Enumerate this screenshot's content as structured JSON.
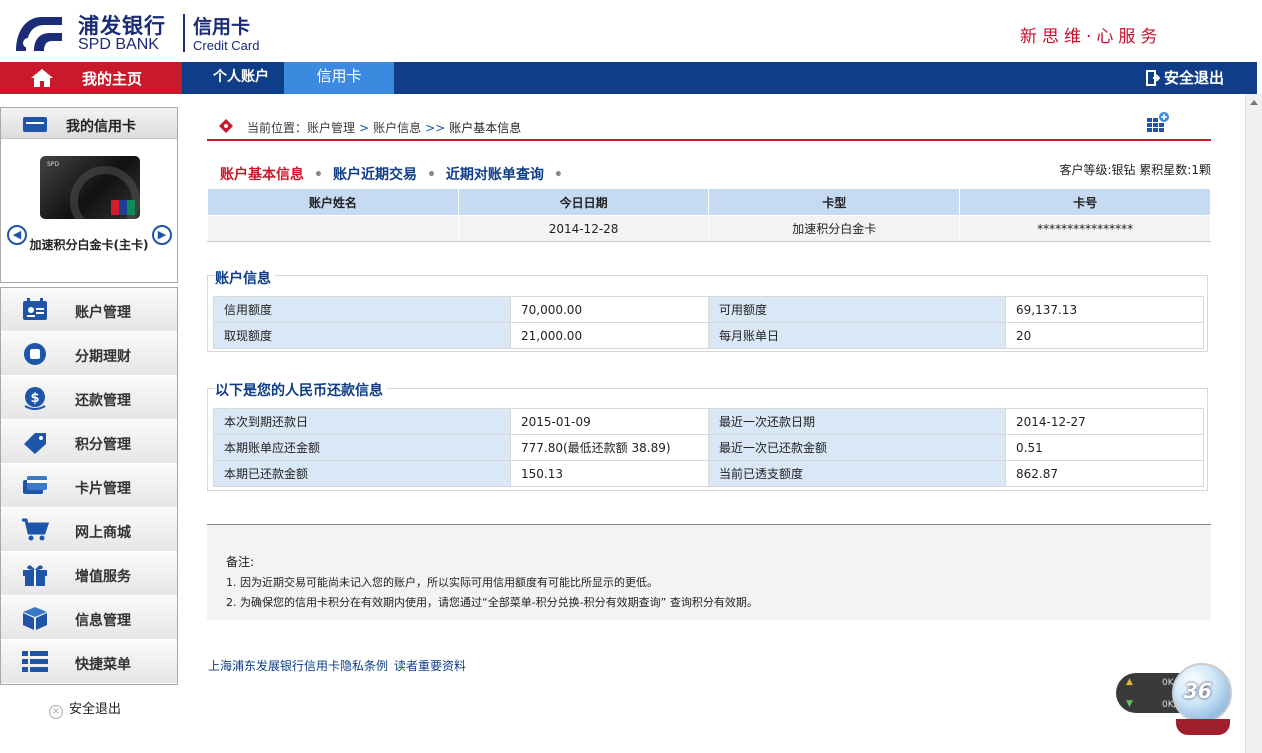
{
  "brand": {
    "name_cn": "浦发银行",
    "name_en": "SPD BANK",
    "product_cn": "信用卡",
    "product_en": "Credit Card",
    "slogan": "新思维·心服务",
    "accent_red": "#c81a2a",
    "accent_blue": "#0f3d87"
  },
  "nav": {
    "home": "我的主页",
    "personal": "个人账户",
    "credit": "信用卡",
    "logout": "安全退出"
  },
  "sidebar": {
    "card_header": "我的信用卡",
    "card_name": "加速积分白金卡(主卡)",
    "menu": [
      {
        "label": "账户管理",
        "icon": "account-icon"
      },
      {
        "label": "分期理财",
        "icon": "installment-icon"
      },
      {
        "label": "还款管理",
        "icon": "repayment-icon"
      },
      {
        "label": "积分管理",
        "icon": "points-icon"
      },
      {
        "label": "卡片管理",
        "icon": "card-manage-icon"
      },
      {
        "label": "网上商城",
        "icon": "cart-icon"
      },
      {
        "label": "增值服务",
        "icon": "gift-icon"
      },
      {
        "label": "信息管理",
        "icon": "box-icon"
      },
      {
        "label": "快捷菜单",
        "icon": "list-icon"
      }
    ],
    "logout": "安全退出"
  },
  "breadcrumb": {
    "prefix": "当前位置：",
    "level1": "账户管理",
    "level2": "账户信息",
    "current": "账户基本信息"
  },
  "tabs": {
    "basic": "账户基本信息",
    "recent": "账户近期交易",
    "bills": "近期对账单查询"
  },
  "customer_level": "客户等级:银钻 累积星数:1颗",
  "summary": {
    "headers": [
      "账户姓名",
      "今日日期",
      "卡型",
      "卡号"
    ],
    "row": [
      "",
      "2014-12-28",
      "加速积分白金卡",
      "****************"
    ]
  },
  "account_info": {
    "title": "账户信息",
    "rows": [
      [
        "信用额度",
        "70,000.00",
        "可用额度",
        "69,137.13"
      ],
      [
        "取现额度",
        "21,000.00",
        "每月账单日",
        "20"
      ]
    ]
  },
  "repayment_info": {
    "title": "以下是您的人民币还款信息",
    "rows": [
      [
        "本次到期还款日",
        "2015-01-09",
        "最近一次还款日期",
        "2014-12-27"
      ],
      [
        "本期账单应还金额",
        "777.80(最低还款额 38.89)",
        "最近一次已还款金额",
        "0.51"
      ],
      [
        "本期已还款金额",
        "150.13",
        "当前已透支额度",
        "862.87"
      ]
    ]
  },
  "notes": {
    "title": "备注:",
    "items": [
      "1. 因为近期交易可能尚未记入您的账户，所以实际可用信用额度有可能比所显示的更低。",
      "2. 为确保您的信用卡积分在有效期内使用，请您通过“全部菜单-积分兑换-积分有效期查询” 查询积分有效期。"
    ]
  },
  "footer_links": {
    "privacy": "上海浦东发展银行信用卡隐私条例",
    "important": "读者重要资料"
  },
  "widget": {
    "up": "0K/s",
    "down": "0K/s",
    "badge": "36"
  }
}
